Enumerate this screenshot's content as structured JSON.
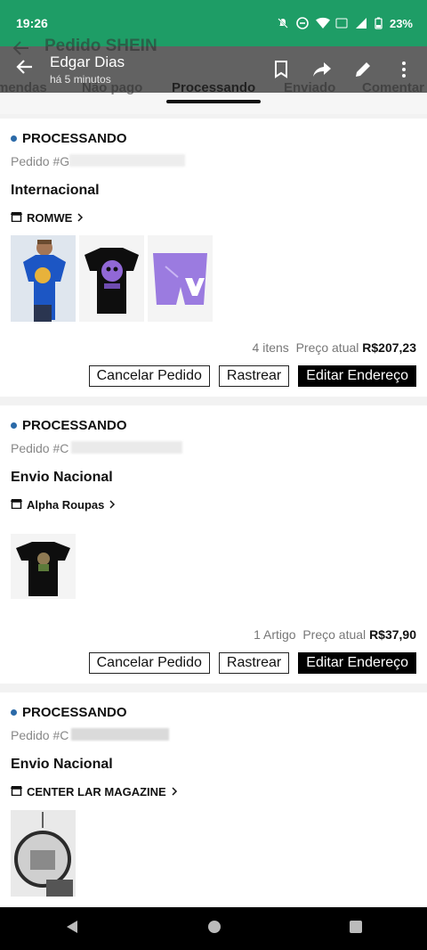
{
  "status_bar": {
    "time": "19:26",
    "battery": "23%"
  },
  "shein": {
    "title": "Pedido SHEIN",
    "tabs": [
      {
        "label": "mendas"
      },
      {
        "label": "Não pago"
      },
      {
        "label": "Processando"
      },
      {
        "label": "Enviado"
      },
      {
        "label": "Comentar"
      }
    ]
  },
  "overlay": {
    "name": "Edgar Dias",
    "time": "há 5 minutos"
  },
  "orders": [
    {
      "status": "PROCESSANDO",
      "order_prefix": "Pedido #G",
      "shipping": "Internacional",
      "store": "ROMWE",
      "count": "4 itens",
      "price_label": "Preço atual",
      "price": "R$207,23",
      "buttons": {
        "cancel": "Cancelar Pedido",
        "track": "Rastrear",
        "edit": "Editar Endereço"
      }
    },
    {
      "status": "PROCESSANDO",
      "order_prefix": "Pedido #C",
      "shipping": "Envio Nacional",
      "store": "Alpha Roupas",
      "count": "1 Artigo",
      "price_label": "Preço atual",
      "price": "R$37,90",
      "buttons": {
        "cancel": "Cancelar Pedido",
        "track": "Rastrear",
        "edit": "Editar Endereço"
      }
    },
    {
      "status": "PROCESSANDO",
      "order_prefix": "Pedido #C",
      "shipping": "Envio Nacional",
      "store": "CENTER LAR MAGAZINE"
    }
  ],
  "colors": {
    "status_bar": "#1e9d66",
    "status_dot": "#2b6aa8",
    "primary_button": "#000000"
  }
}
